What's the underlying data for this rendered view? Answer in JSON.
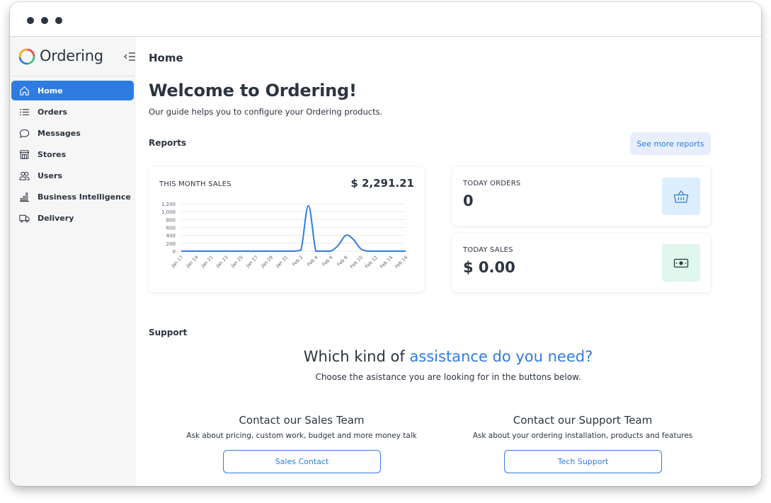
{
  "app": {
    "name": "Ordering",
    "accent_color": "#2f7ce0",
    "logo_colors": [
      "#e94b3c",
      "#f5a623",
      "#2f7ce0",
      "#3ec07a"
    ]
  },
  "sidebar": {
    "items": [
      {
        "label": "Home",
        "icon": "home-icon",
        "active": true
      },
      {
        "label": "Orders",
        "icon": "list-icon",
        "active": false
      },
      {
        "label": "Messages",
        "icon": "chat-bubble-icon",
        "active": false
      },
      {
        "label": "Stores",
        "icon": "store-icon",
        "active": false
      },
      {
        "label": "Users",
        "icon": "users-icon",
        "active": false
      },
      {
        "label": "Business Intelligence",
        "icon": "bar-chart-icon",
        "active": false
      },
      {
        "label": "Delivery",
        "icon": "truck-icon",
        "active": false
      }
    ]
  },
  "main": {
    "page_title": "Home",
    "welcome": "Welcome to Ordering!",
    "subtitle": "Our guide helps you to configure your Ordering products.",
    "reports_label": "Reports",
    "see_more_label": "See more reports",
    "sales_card": {
      "label": "THIS MONTH SALES",
      "amount": "$ 2,291.21"
    },
    "orders_card": {
      "label": "TODAY ORDERS",
      "value": "0",
      "icon": "basket-icon",
      "tile_color": "#dceefd"
    },
    "today_sales_card": {
      "label": "TODAY SALES",
      "value": "$ 0.00",
      "icon": "cash-icon",
      "tile_color": "#dff7ec"
    }
  },
  "support": {
    "label": "Support",
    "heading_plain": "Which kind of ",
    "heading_accent": "assistance do you need?",
    "subtitle": "Choose the asistance you are looking for in the buttons below.",
    "sales": {
      "title": "Contact our Sales Team",
      "description": "Ask about pricing, custom work, budget and more money talk",
      "button": "Sales Contact"
    },
    "tech": {
      "title": "Contact our Support Team",
      "description": "Ask about your ordering installation, products and features",
      "button": "Tech Support"
    }
  },
  "chart_data": {
    "type": "line",
    "x": [
      "Jan 17",
      "Jan 18",
      "Jan 19",
      "Jan 20",
      "Jan 21",
      "Jan 22",
      "Jan 23",
      "Jan 24",
      "Jan 25",
      "Jan 26",
      "Jan 27",
      "Jan 28",
      "Jan 29",
      "Jan 30",
      "Jan 31",
      "Feb 1",
      "Feb 2",
      "Feb 3",
      "Feb 4",
      "Feb 5",
      "Feb 6",
      "Feb 7",
      "Feb 8",
      "Feb 9",
      "Feb 10",
      "Feb 11",
      "Feb 12",
      "Feb 13",
      "Feb 14",
      "Feb 15",
      "Feb 16"
    ],
    "tick_labels": [
      "Jan 17",
      "Jan 19",
      "Jan 21",
      "Jan 23",
      "Jan 25",
      "Jan 27",
      "Jan 29",
      "Jan 31",
      "Feb 2",
      "Feb 4",
      "Feb 6",
      "Feb 8",
      "Feb 10",
      "Feb 12",
      "Feb 14",
      "Feb 16"
    ],
    "series": [
      {
        "values": [
          0,
          0,
          0,
          0,
          0,
          0,
          0,
          0,
          0,
          0,
          0,
          0,
          0,
          0,
          0,
          0,
          30,
          1150,
          0,
          0,
          0,
          150,
          400,
          300,
          60,
          0,
          0,
          0,
          0,
          0,
          0
        ],
        "color": "#2f7ce0"
      }
    ],
    "ylim": [
      0,
      1200
    ],
    "yticks": [
      0,
      200,
      400,
      600,
      800,
      1000,
      1200
    ],
    "ytick_labels": [
      "0",
      "200",
      "400",
      "600",
      "800",
      "1,000",
      "1,200"
    ],
    "grid": true,
    "legend": "none"
  }
}
